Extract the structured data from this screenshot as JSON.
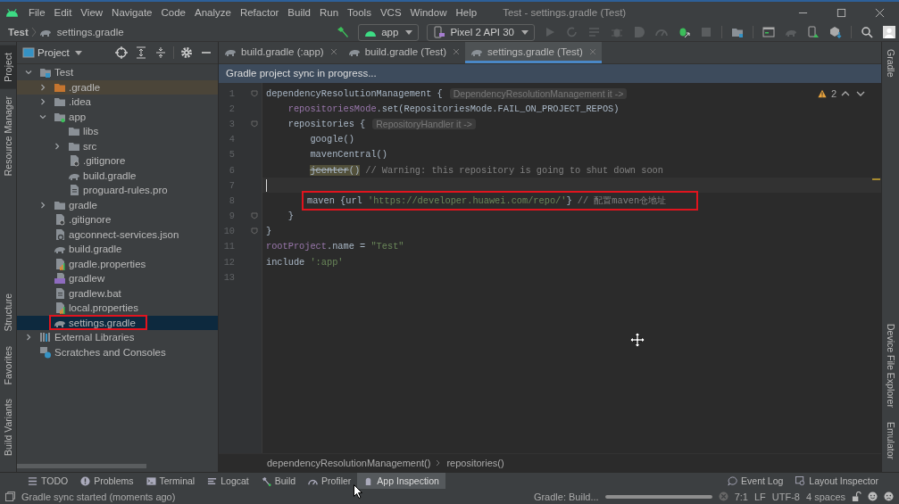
{
  "window": {
    "title": "Test - settings.gradle (Test)"
  },
  "menu": [
    "File",
    "Edit",
    "View",
    "Navigate",
    "Code",
    "Analyze",
    "Refactor",
    "Build",
    "Run",
    "Tools",
    "VCS",
    "Window",
    "Help"
  ],
  "breadcrumb": [
    "Test",
    "settings.gradle"
  ],
  "toolbar": {
    "run_config": "app",
    "device": "Pixel 2 API 30"
  },
  "left_strip_top": [
    {
      "label": "Project",
      "selected": true
    },
    {
      "label": "Resource Manager",
      "selected": false
    }
  ],
  "left_strip_bottom": [
    {
      "label": "Structure",
      "selected": false
    },
    {
      "label": "Favorites",
      "selected": false
    },
    {
      "label": "Build Variants",
      "selected": false
    }
  ],
  "project": {
    "view": "Project",
    "tree": [
      {
        "label": "Test",
        "kind": "root",
        "expanded": true,
        "selected": false,
        "children": [
          {
            "label": ".gradle",
            "kind": "excluded",
            "expanded": false,
            "selected": false
          },
          {
            "label": ".idea",
            "kind": "folder",
            "expanded": false,
            "selected": false
          },
          {
            "label": "app",
            "kind": "module",
            "expanded": true,
            "selected": false,
            "children": [
              {
                "label": "libs",
                "kind": "folder",
                "selected": false
              },
              {
                "label": "src",
                "kind": "folder",
                "expanded": false,
                "selected": false
              },
              {
                "label": ".gitignore",
                "kind": "ignore",
                "selected": false
              },
              {
                "label": "build.gradle",
                "kind": "gradle",
                "selected": false
              },
              {
                "label": "proguard-rules.pro",
                "kind": "file",
                "selected": false
              }
            ]
          },
          {
            "label": "gradle",
            "kind": "folder",
            "expanded": false,
            "selected": false
          },
          {
            "label": ".gitignore",
            "kind": "ignore",
            "selected": false
          },
          {
            "label": "agconnect-services.json",
            "kind": "json",
            "selected": false
          },
          {
            "label": "build.gradle",
            "kind": "gradle",
            "selected": false
          },
          {
            "label": "gradle.properties",
            "kind": "properties",
            "selected": false
          },
          {
            "label": "gradlew",
            "kind": "script",
            "selected": false
          },
          {
            "label": "gradlew.bat",
            "kind": "file",
            "selected": false
          },
          {
            "label": "local.properties",
            "kind": "properties",
            "selected": false
          },
          {
            "label": "settings.gradle",
            "kind": "gradle",
            "selected": true,
            "annotated": true
          }
        ]
      },
      {
        "label": "External Libraries",
        "kind": "libraries",
        "expanded": false,
        "selected": false
      },
      {
        "label": "Scratches and Consoles",
        "kind": "scratches",
        "selected": false
      }
    ]
  },
  "editor_tabs": [
    {
      "label": "build.gradle (:app)",
      "selected": false
    },
    {
      "label": "build.gradle (Test)",
      "selected": false
    },
    {
      "label": "settings.gradle (Test)",
      "selected": true
    }
  ],
  "notification": "Gradle project sync in progress...",
  "editor": {
    "warnings": "2",
    "lines": [
      {
        "number": "1",
        "fold": true,
        "tokens": [
          {
            "text": "dependencyResolutionManagement {",
            "kind": "plain"
          }
        ],
        "hint": "DependencyResolutionManagement it ->"
      },
      {
        "number": "2",
        "tokens": [
          {
            "text": "    repositoriesMode",
            "kind": "field"
          },
          {
            "text": ".set(RepositoriesMode.FAIL_ON_PROJECT_REPOS)",
            "kind": "plain"
          }
        ]
      },
      {
        "number": "3",
        "fold": true,
        "tokens": [
          {
            "text": "    repositories {",
            "kind": "plain"
          }
        ],
        "hint": "RepositoryHandler it ->"
      },
      {
        "number": "4",
        "tokens": [
          {
            "text": "        google()",
            "kind": "plain"
          }
        ]
      },
      {
        "number": "5",
        "tokens": [
          {
            "text": "        mavenCentral()",
            "kind": "plain"
          }
        ]
      },
      {
        "number": "6",
        "tokens": [
          {
            "text": "        jcenter",
            "kind": "deprecated"
          },
          {
            "text": "()",
            "kind": "warned"
          },
          {
            "text": " // Warning: this repository is going to shut down soon",
            "kind": "comment"
          }
        ]
      },
      {
        "number": "7",
        "current": true
      },
      {
        "number": "8",
        "annotated": true,
        "tokens": [
          {
            "text": "maven {url ",
            "kind": "plain"
          },
          {
            "text": "'https://developer.huawei.com/repo/'",
            "kind": "string"
          },
          {
            "text": "} ",
            "kind": "plain"
          },
          {
            "text": "// 配置maven仓地址",
            "kind": "comment"
          }
        ]
      },
      {
        "number": "9",
        "fold": true,
        "tokens": [
          {
            "text": "    }",
            "kind": "plain"
          }
        ]
      },
      {
        "number": "10",
        "fold": true,
        "tokens": [
          {
            "text": "}",
            "kind": "plain"
          }
        ]
      },
      {
        "number": "11",
        "tokens": [
          {
            "text": "rootProject",
            "kind": "field"
          },
          {
            "text": ".name = ",
            "kind": "plain"
          },
          {
            "text": "\"Test\"",
            "kind": "string"
          }
        ]
      },
      {
        "number": "12",
        "tokens": [
          {
            "text": "include ",
            "kind": "plain"
          },
          {
            "text": "':app'",
            "kind": "string"
          }
        ]
      },
      {
        "number": "13"
      }
    ],
    "breadcrumbs": [
      "dependencyResolutionManagement()",
      "repositories()"
    ]
  },
  "right_strip_top": [
    {
      "label": "Gradle",
      "selected": false
    }
  ],
  "right_strip_bottom": [
    {
      "label": "Device File Explorer",
      "selected": false
    },
    {
      "label": "Emulator",
      "selected": false
    }
  ],
  "tool_windows_left": [
    {
      "label": "TODO",
      "kind": "todo",
      "selected": false
    },
    {
      "label": "Problems",
      "kind": "problems",
      "selected": false
    },
    {
      "label": "Terminal",
      "kind": "terminal",
      "selected": false
    },
    {
      "label": "Logcat",
      "kind": "logcat",
      "selected": false
    },
    {
      "label": "Build",
      "kind": "build",
      "selected": false
    },
    {
      "label": "Profiler",
      "kind": "profiler",
      "selected": false
    },
    {
      "label": "App Inspection",
      "kind": "inspection",
      "selected": true
    }
  ],
  "tool_windows_right": [
    {
      "label": "Event Log",
      "kind": "log",
      "selected": false
    },
    {
      "label": "Layout Inspector",
      "kind": "layout",
      "selected": false
    }
  ],
  "status": {
    "message": "Gradle sync started (moments ago)",
    "task": "Gradle: Build...",
    "level": 1,
    "position": "7:1",
    "line_separator": "LF",
    "encoding": "UTF-8",
    "indent": "4 spaces"
  }
}
